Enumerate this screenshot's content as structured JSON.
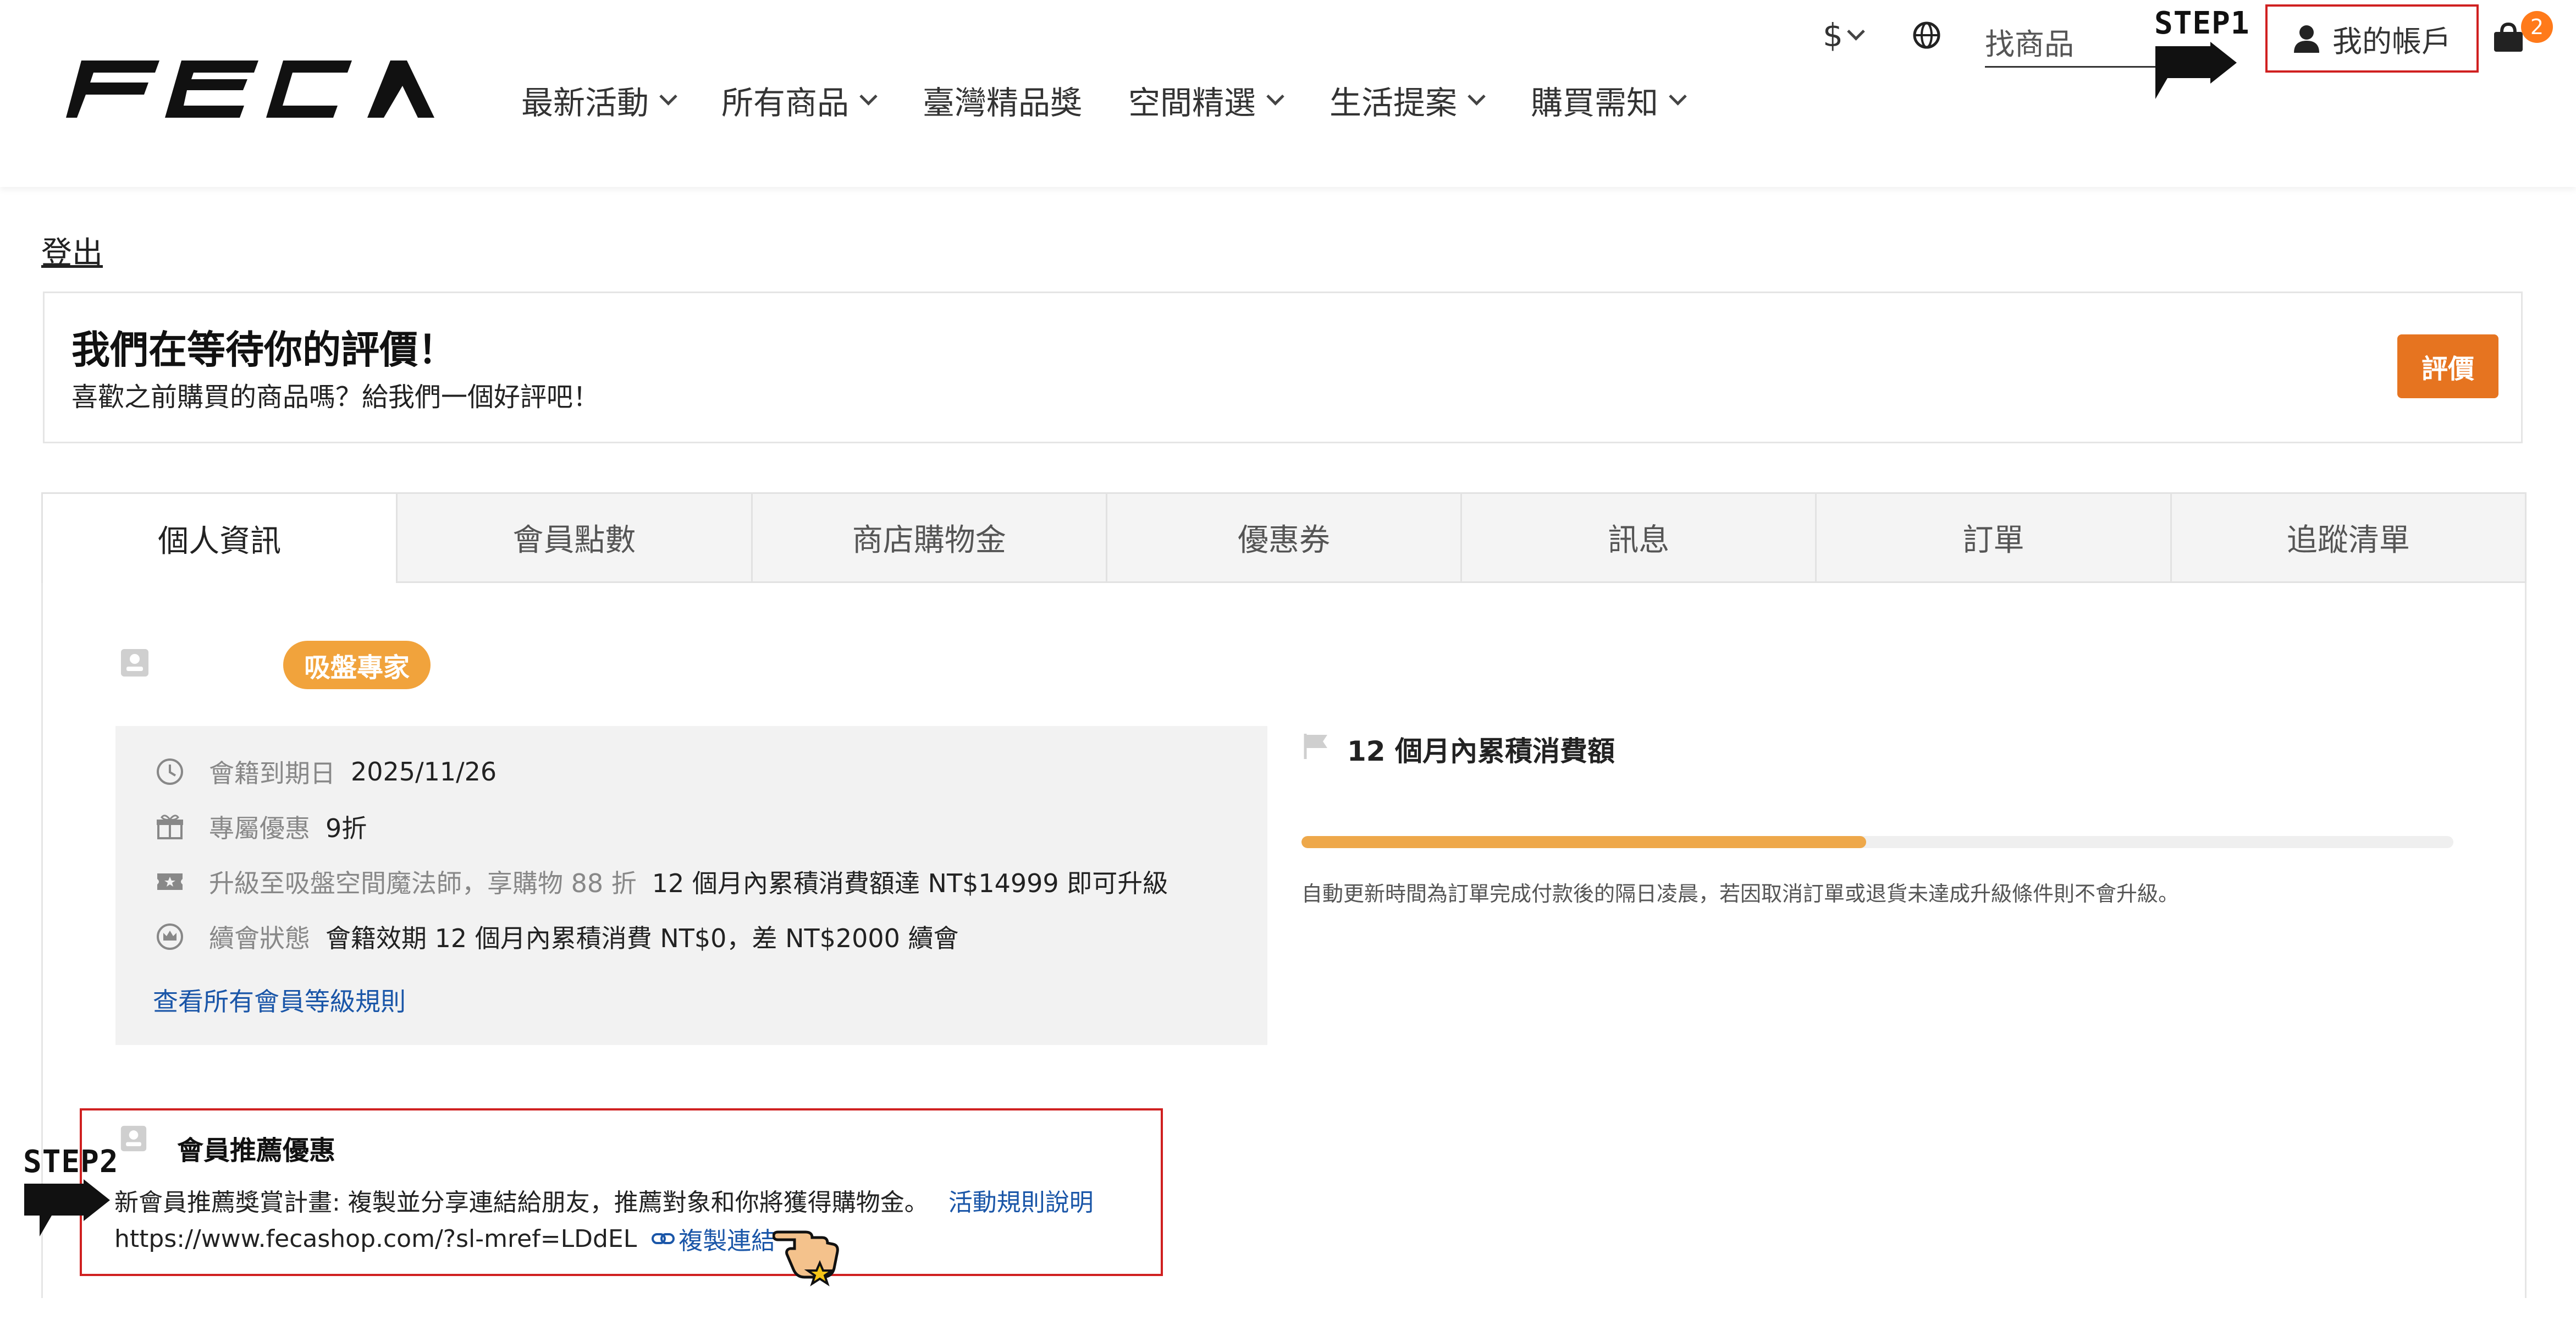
{
  "header": {
    "logo_text": "FECA",
    "nav": [
      {
        "label": "最新活動",
        "has_dropdown": true
      },
      {
        "label": "所有商品",
        "has_dropdown": true
      },
      {
        "label": "臺灣精品獎",
        "has_dropdown": false
      },
      {
        "label": "空間精選",
        "has_dropdown": true
      },
      {
        "label": "生活提案",
        "has_dropdown": true
      },
      {
        "label": "購買需知",
        "has_dropdown": true
      }
    ],
    "currency_symbol": "$",
    "search_placeholder": "找商品",
    "account_label": "我的帳戶",
    "cart_count": "2",
    "step1_label": "STEP1"
  },
  "logout_label": "登出",
  "review_banner": {
    "title": "我們在等待你的評價！",
    "subtitle": "喜歡之前購買的商品嗎？給我們一個好評吧！",
    "button_label": "評價"
  },
  "tabs": [
    {
      "label": "個人資訊",
      "active": true
    },
    {
      "label": "會員點數",
      "active": false
    },
    {
      "label": "商店購物金",
      "active": false
    },
    {
      "label": "優惠券",
      "active": false
    },
    {
      "label": "訊息",
      "active": false
    },
    {
      "label": "訂單",
      "active": false
    },
    {
      "label": "追蹤清單",
      "active": false
    }
  ],
  "member": {
    "level_badge": "吸盤專家",
    "rows": [
      {
        "icon": "clock-icon",
        "label": "會籍到期日",
        "value": "2025/11/26"
      },
      {
        "icon": "gift-icon",
        "label": "專屬優惠",
        "value": "9折"
      },
      {
        "icon": "ticket-icon",
        "label": "升級至吸盤空間魔法師，享購物 88 折",
        "value": "12 個月內累積消費額達 NT$14999 即可升級"
      },
      {
        "icon": "crown-icon",
        "label": "續會狀態",
        "value": "會籍效期 12 個月內累積消費 NT$0，差 NT$2000 續會"
      }
    ],
    "rules_link": "查看所有會員等級規則"
  },
  "progress": {
    "title": "12 個月內累積消費額",
    "fill_fraction": 0.49,
    "note": "自動更新時間為訂單完成付款後的隔日凌晨，若因取消訂單或退貨未達成升級條件則不會升級。"
  },
  "referral": {
    "title": "會員推薦優惠",
    "description": "新會員推薦獎賞計畫: 複製並分享連結給朋友，推薦對象和你將獲得購物金。",
    "rules_link": "活動規則說明",
    "url": "https://www.fecashop.com/?sl-mref=LDdEL",
    "copy_label": "複製連結",
    "step2_label": "STEP2"
  },
  "colors": {
    "accent_orange": "#e67420",
    "badge_orange": "#f1a33c",
    "progress_fill": "#eea84a",
    "highlight_red": "#d02020",
    "link_blue": "#1a56a8"
  }
}
